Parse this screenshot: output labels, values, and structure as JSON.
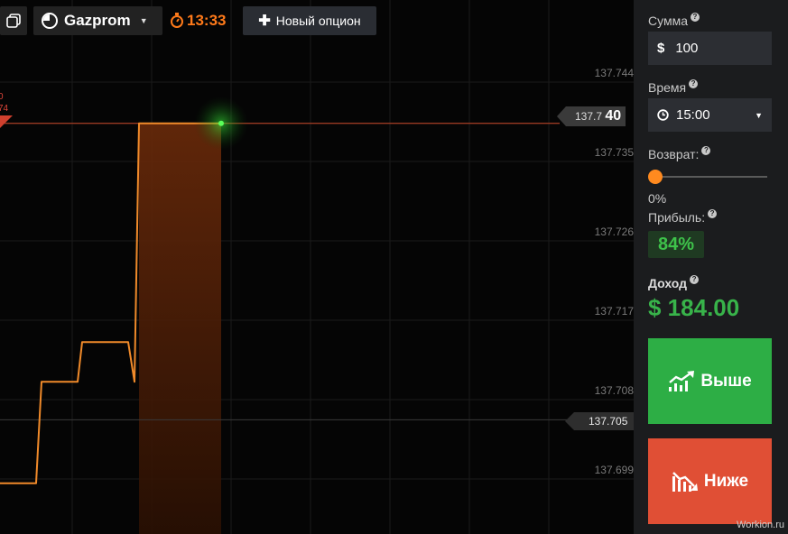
{
  "toolbar": {
    "asset_name": "Gazprom",
    "timer": "13:33",
    "new_option_label": "Новый опцион",
    "accent_color": "#ff7a1a"
  },
  "chart": {
    "y_ticks": [
      "137.744",
      "137.735",
      "137.726",
      "137.717",
      "137.708",
      "137.699"
    ],
    "current_price_prefix": "137.7",
    "current_price_suffix": "40",
    "strike_price": "137.705",
    "clipped_labels": [
      "0",
      "74"
    ]
  },
  "chart_data": {
    "type": "line",
    "ylim": [
      137.695,
      137.748
    ],
    "y_ticks": [
      137.744,
      137.735,
      137.726,
      137.717,
      137.708,
      137.699
    ],
    "series": [
      {
        "values": [
          [
            0,
            137.6975
          ],
          [
            1,
            137.6975
          ],
          [
            2,
            137.709
          ],
          [
            3,
            137.709
          ],
          [
            4,
            137.7135
          ],
          [
            5,
            137.7135
          ],
          [
            6,
            137.709
          ],
          [
            7,
            137.7383
          ],
          [
            8,
            137.7383
          ],
          [
            9,
            137.7383
          ]
        ]
      }
    ],
    "current_price": 137.74,
    "strike_price": 137.705,
    "line_color": "#f08a2a"
  },
  "panel": {
    "amount_label": "Сумма",
    "amount_currency": "$",
    "amount_value": "100",
    "time_label": "Время",
    "time_value": "15:00",
    "return_label": "Возврат:",
    "return_value": "0%",
    "return_level": 0,
    "profit_label": "Прибыль:",
    "profit_value": "84%",
    "income_label": "Доход",
    "income_value": "$ 184.00",
    "higher_label": "Выше",
    "lower_label": "Ниже",
    "higher_color": "#2dae45",
    "lower_color": "#e04f35",
    "watermark": "Workion.ru"
  },
  "icons": {
    "windows": "windows-icon",
    "asset": "asset-pie-icon",
    "timer": "stopwatch-icon",
    "help": "question-icon",
    "clock": "clock-icon",
    "up": "chart-up-icon",
    "down": "chart-down-icon"
  }
}
